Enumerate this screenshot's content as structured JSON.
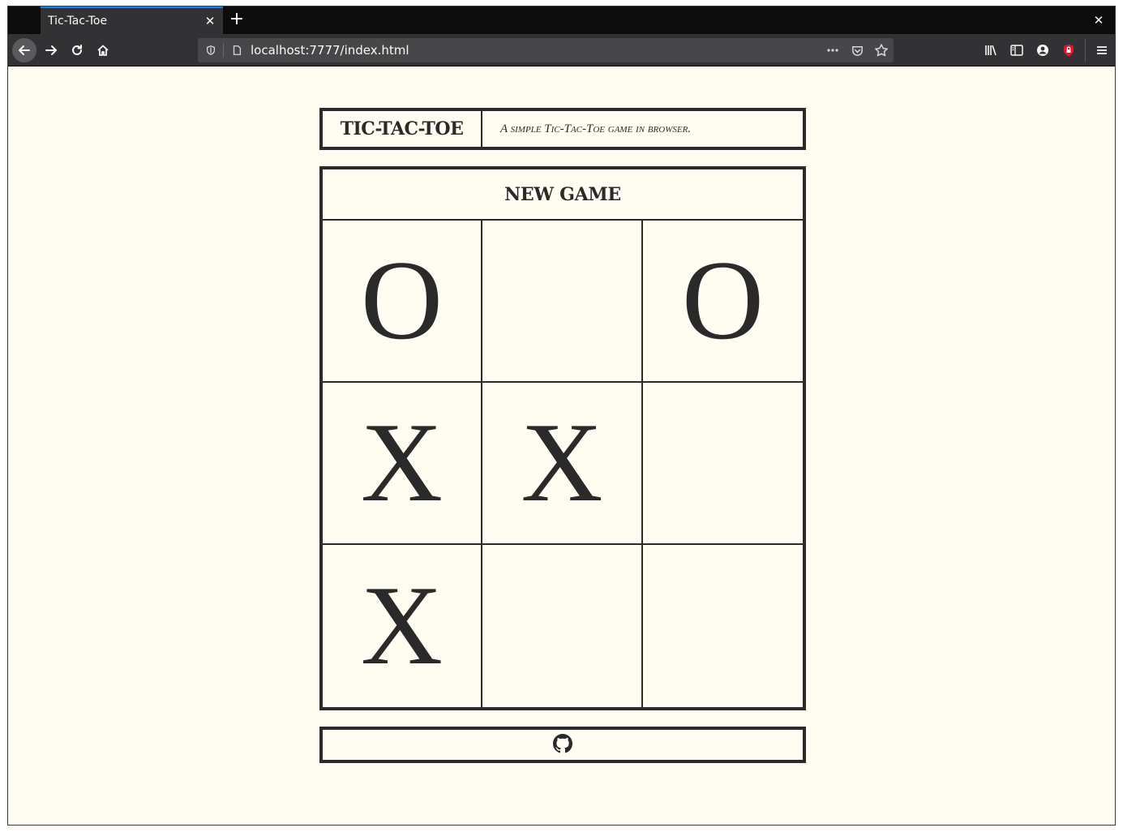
{
  "browser": {
    "tab_title": "Tic-Tac-Toe",
    "tab_close": "✕",
    "new_tab": "+",
    "window_close": "✕",
    "url": "localhost:7777/index.html",
    "icons": [
      "back-arrow-icon",
      "forward-arrow-icon",
      "reload-icon",
      "home-icon",
      "shield-icon",
      "page-icon",
      "more-icon",
      "pocket-icon",
      "bookmark-star-icon",
      "library-icon",
      "sidebar-icon",
      "account-icon",
      "extension-icon",
      "menu-icon"
    ]
  },
  "header": {
    "title": "TIC-TAC-TOE",
    "subtitle": "A simple Tic-Tac-Toe game in browser."
  },
  "game": {
    "new_game_label": "NEW GAME",
    "board": [
      [
        "O",
        "",
        "O"
      ],
      [
        "X",
        "X",
        ""
      ],
      [
        "X",
        "",
        ""
      ]
    ]
  },
  "footer": {
    "link_icon": "github-icon"
  },
  "colors": {
    "page_background": "#fffcf2",
    "ink": "#2a2a2a",
    "tab_accent": "#0a84ff"
  }
}
